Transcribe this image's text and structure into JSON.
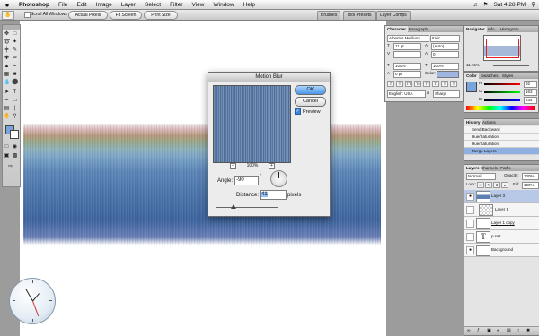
{
  "menubar": {
    "apple": "",
    "app": "Photoshop",
    "items": [
      "File",
      "Edit",
      "Image",
      "Layer",
      "Select",
      "Filter",
      "View",
      "Window",
      "Help"
    ],
    "clock_text": "Sat 4:28 PM"
  },
  "options_bar": {
    "scroll_all_windows": "Scroll All Windows",
    "actual_pixels": "Actual Pixels",
    "fit_screen": "Fit Screen",
    "print_size": "Print Size"
  },
  "well_tabs": [
    "Brushes",
    "Tool Presets",
    "Layer Comps"
  ],
  "character_panel": {
    "tabs": [
      "Character",
      "Paragraph"
    ],
    "font_family": "Albertus Medium",
    "font_style": "Italic",
    "font_size": "11 pt",
    "leading": "(Auto)",
    "kerning": "",
    "tracking": "0",
    "vscale": "100%",
    "hscale": "100%",
    "baseline": "0 pt",
    "color_label": "Color:",
    "style_buttons": [
      "T",
      "T",
      "TT",
      "Tr",
      "T'",
      "T,",
      "T",
      "T"
    ],
    "language": "English: USA",
    "aa": "Sharp"
  },
  "navigator": {
    "tabs": [
      "Navigator",
      "Info",
      "Histogram"
    ],
    "zoom": "11.15%"
  },
  "color_panel": {
    "tabs": [
      "Color",
      "Swatches",
      "Styles"
    ],
    "r": "92",
    "g": "163",
    "b": "234"
  },
  "history": {
    "tabs": [
      "History",
      "Actions"
    ],
    "items": [
      "Send Backward",
      "Hue/Saturation",
      "Hue/Saturation",
      "Merge Layers"
    ]
  },
  "layers": {
    "tabs": [
      "Layers",
      "Channels",
      "Paths"
    ],
    "blend": "Normal",
    "opacity_label": "Opacity:",
    "opacity": "100%",
    "lock_label": "Lock:",
    "fill_label": "Fill:",
    "fill": "100%",
    "rows": [
      "Layer 3",
      "Layer 1",
      "Layer 1 copy",
      "p.swt",
      "Background"
    ]
  },
  "dialog": {
    "title": "Motion Blur",
    "ok": "OK",
    "cancel": "Cancel",
    "preview": "Preview",
    "zoom": "100%",
    "angle_label": "Angle:",
    "angle": "-90",
    "degree": "°",
    "distance_label": "Distance:",
    "distance": "41",
    "pixels": "pixels"
  },
  "colors": {
    "fg_swatch": "#7aa4dc",
    "accent": "#4a96e8"
  }
}
